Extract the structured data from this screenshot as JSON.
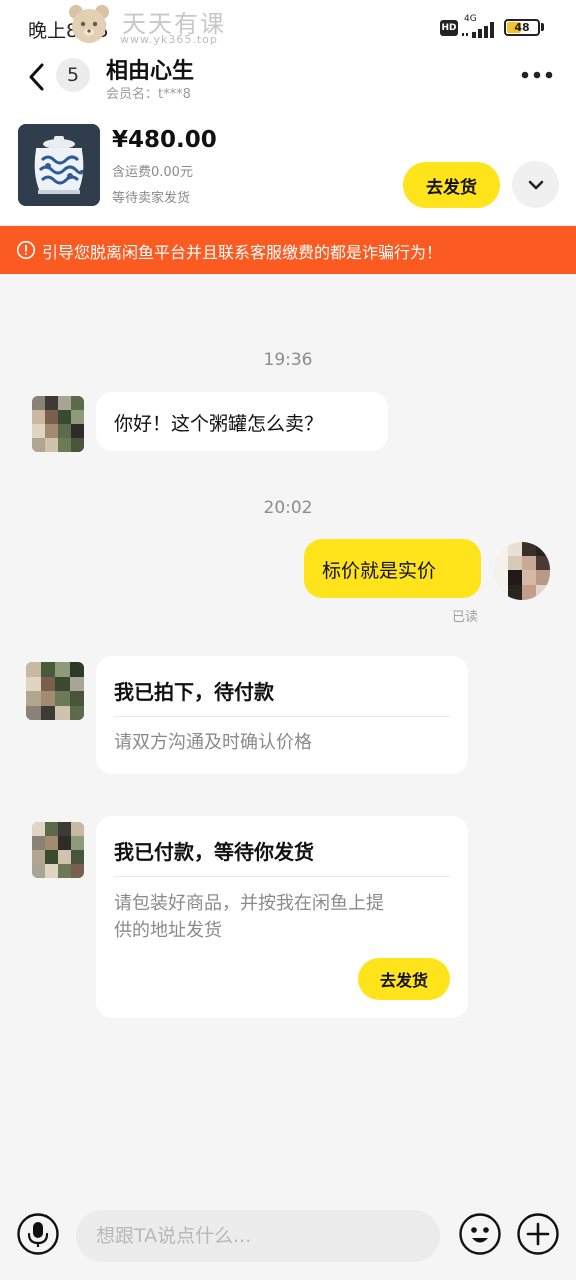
{
  "status_bar": {
    "time": "晚上8:05",
    "network": "4G",
    "battery": "48",
    "battery_level": 0.48,
    "hd": "HD"
  },
  "watermark": {
    "title": "天天有课",
    "url": "www.yk365.top"
  },
  "header": {
    "back_icon": "chevron-left-icon",
    "unread_count": "5",
    "contact_name": "相由心生",
    "member_label": "会员名：t***8",
    "more_icon": "more-horizontal-icon"
  },
  "product": {
    "price": "¥480.00",
    "shipping": "含运费0.00元",
    "status": "等待卖家发货",
    "ship_button": "去发货",
    "expand_icon": "chevron-down-icon"
  },
  "warning": {
    "icon": "alert-circle-icon",
    "text": "引导您脱离闲鱼平台并且联系客服缴费的都是诈骗行为！"
  },
  "chat": {
    "messages": [
      {
        "type": "timestamp",
        "text": "19:36"
      },
      {
        "type": "incoming",
        "text": "你好！这个粥罐怎么卖？"
      },
      {
        "type": "timestamp",
        "text": "20:02"
      },
      {
        "type": "outgoing",
        "text": "标价就是实价",
        "read": "已读"
      },
      {
        "type": "card",
        "title": "我已拍下，待付款",
        "body": "请双方沟通及时确认价格"
      },
      {
        "type": "card",
        "title": "我已付款，等待你发货",
        "body_line1": "请包装好商品，并按我在闲鱼上提",
        "body_line2": "供的地址发货",
        "button": "去发货"
      }
    ]
  },
  "composer": {
    "placeholder": "想跟TA说点什么...",
    "voice_icon": "microphone-icon",
    "emoji_icon": "emoji-icon",
    "plus_icon": "plus-circle-icon"
  },
  "colors": {
    "accent_yellow": "#ffe31b",
    "warning_orange": "#fb5a21",
    "background": "#f5f5f5"
  }
}
